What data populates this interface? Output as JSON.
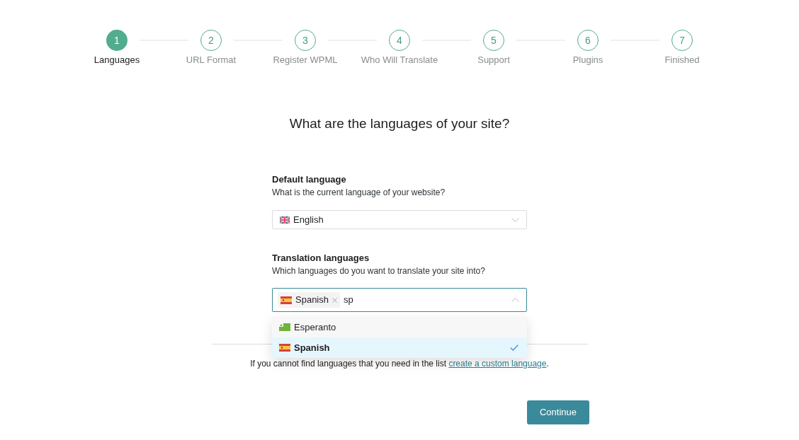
{
  "steps": [
    {
      "number": "1",
      "label": "Languages",
      "selected": true
    },
    {
      "number": "2",
      "label": "URL Format",
      "selected": false
    },
    {
      "number": "3",
      "label": "Register WPML",
      "selected": false
    },
    {
      "number": "4",
      "label": "Who Will Translate",
      "selected": false
    },
    {
      "number": "5",
      "label": "Support",
      "selected": false
    },
    {
      "number": "6",
      "label": "Plugins",
      "selected": false
    },
    {
      "number": "7",
      "label": "Finished",
      "selected": false
    }
  ],
  "title": "What are the languages of your site?",
  "default_language": {
    "label": "Default language",
    "description": "What is the current language of your website?",
    "value": {
      "label": "English",
      "kind": "gb"
    },
    "expanded": false
  },
  "translation_languages": {
    "label": "Translation languages",
    "description": "Which languages do you want to translate your site into?",
    "chips": [
      {
        "label": "Spanish",
        "kind": "es"
      }
    ],
    "value": "sp",
    "expanded": true,
    "options": [
      {
        "label": "Esperanto",
        "kind": "eo",
        "selected": false
      },
      {
        "label": "Spanish",
        "kind": "es",
        "selected": true
      }
    ]
  },
  "note": {
    "text": "If you cannot find languages that you need in the list ",
    "link": "create a custom language",
    "end": "."
  },
  "continue_button": "Continue"
}
